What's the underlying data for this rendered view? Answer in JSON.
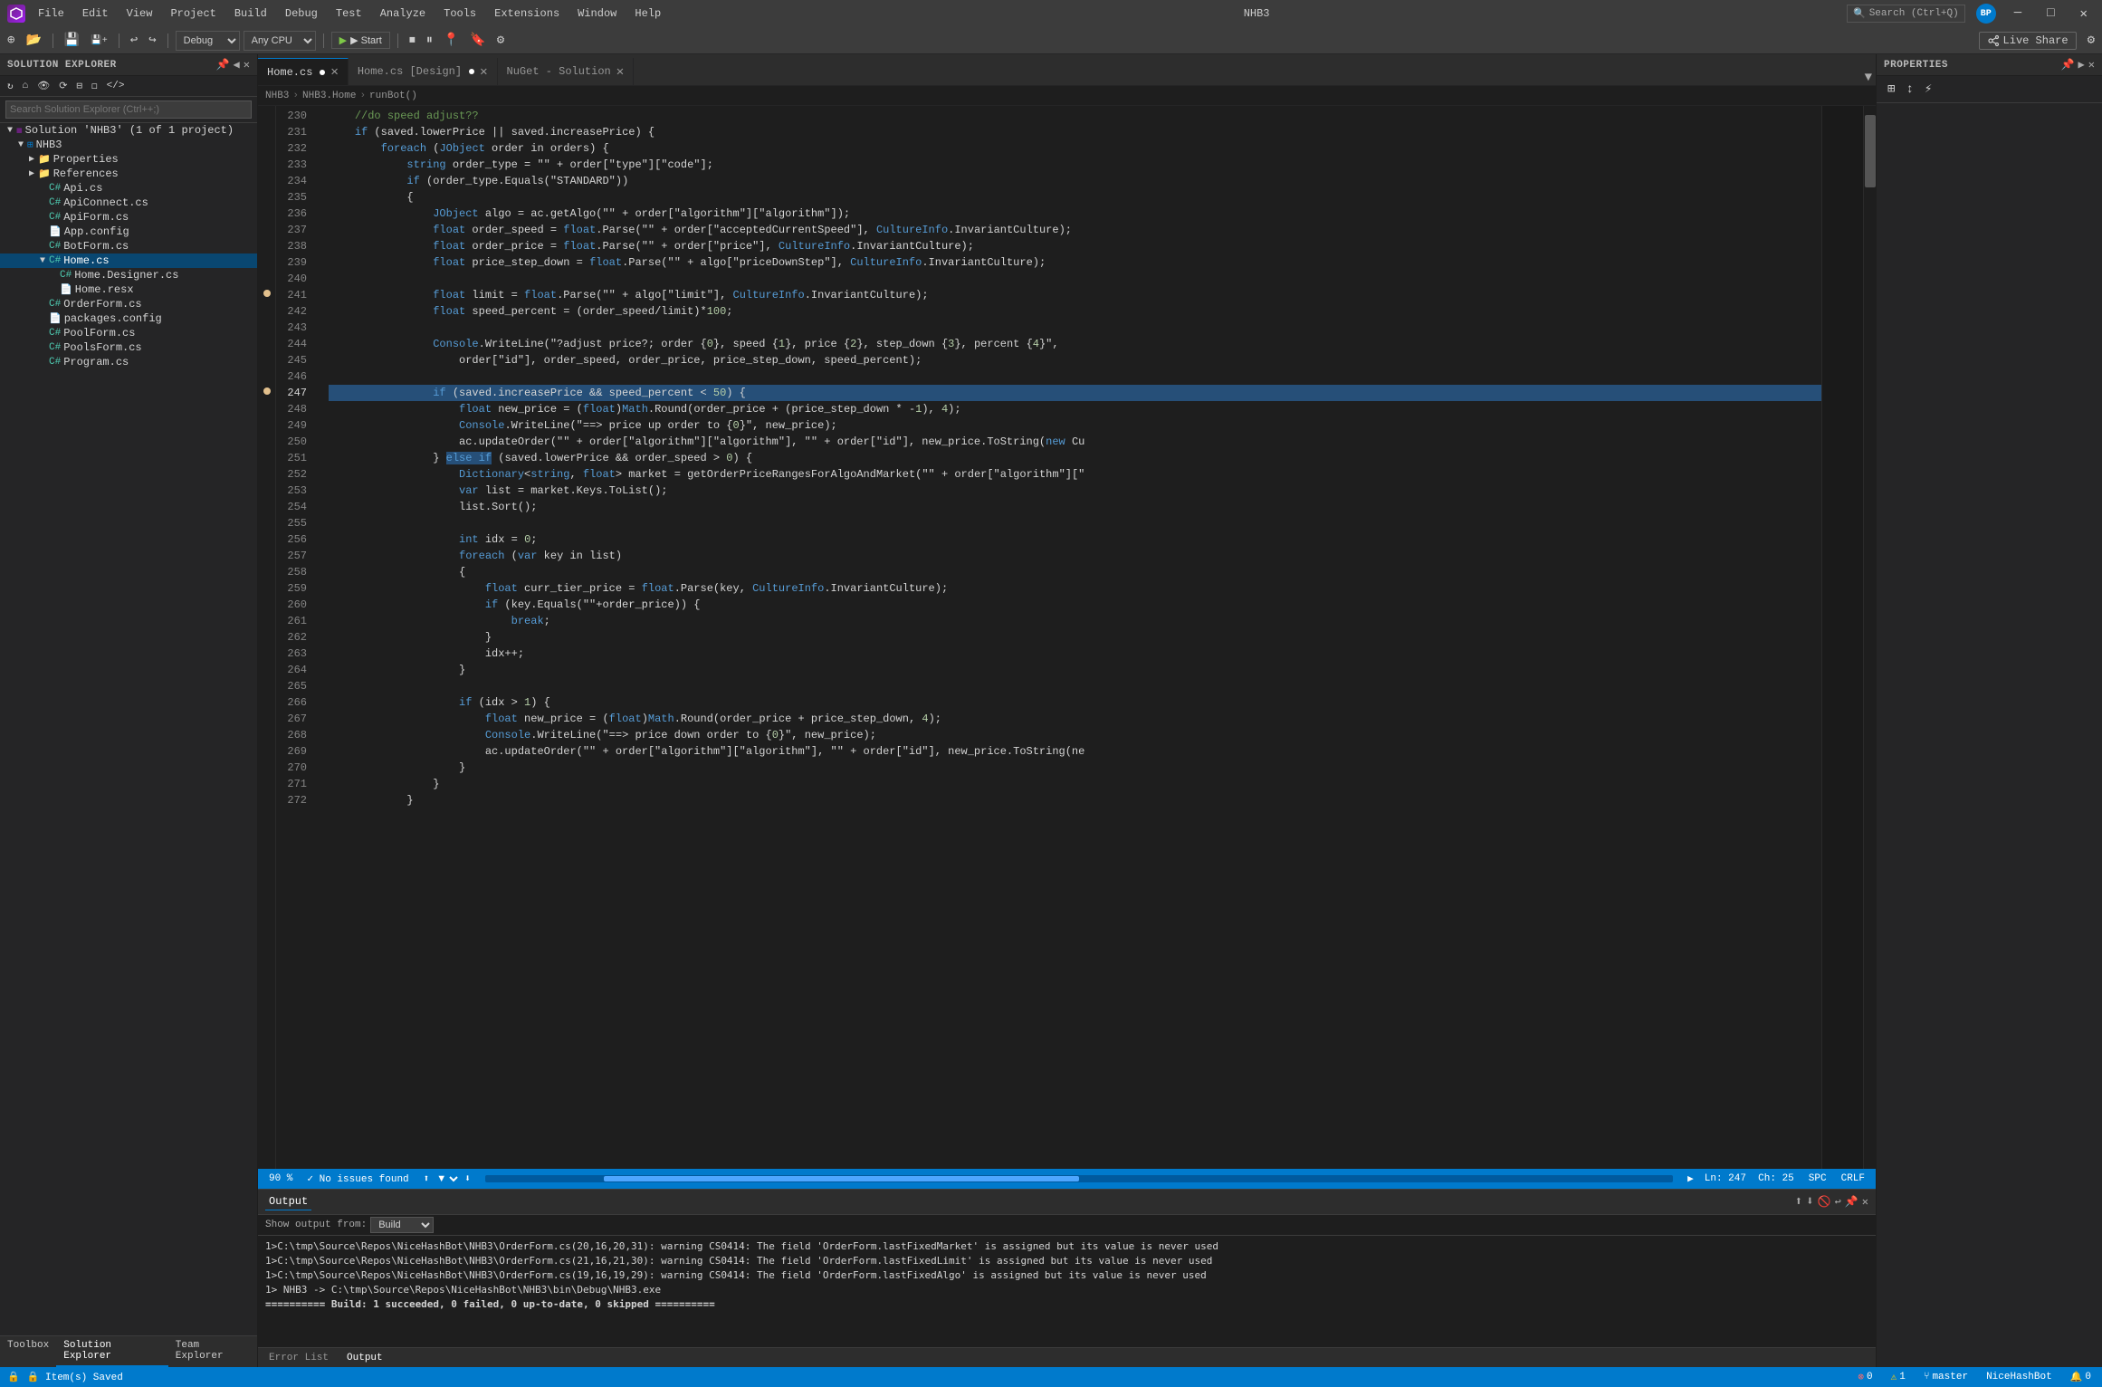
{
  "titleBar": {
    "appName": "NHB3",
    "minimize": "─",
    "maximize": "□",
    "close": "✕"
  },
  "menuBar": {
    "items": [
      "File",
      "Edit",
      "View",
      "Project",
      "Build",
      "Debug",
      "Test",
      "Analyze",
      "Tools",
      "Extensions",
      "Window",
      "Help"
    ]
  },
  "toolbar": {
    "debugMode": "Debug",
    "platform": "Any CPU",
    "startLabel": "▶ Start",
    "liveShare": "Live Share"
  },
  "solutionExplorer": {
    "title": "Solution Explorer",
    "searchPlaceholder": "Search Solution Explorer (Ctrl++;)",
    "tree": [
      {
        "label": "Solution 'NHB3' (1 of 1 project)",
        "indent": 0,
        "type": "solution",
        "arrow": "▼"
      },
      {
        "label": "NHB3",
        "indent": 1,
        "type": "project",
        "arrow": "▼"
      },
      {
        "label": "Properties",
        "indent": 2,
        "type": "folder",
        "arrow": "▶"
      },
      {
        "label": "References",
        "indent": 2,
        "type": "folder",
        "arrow": "▶"
      },
      {
        "label": "Api.cs",
        "indent": 3,
        "type": "cs",
        "arrow": ""
      },
      {
        "label": "ApiConnect.cs",
        "indent": 3,
        "type": "cs",
        "arrow": ""
      },
      {
        "label": "ApiForm.cs",
        "indent": 3,
        "type": "cs",
        "arrow": ""
      },
      {
        "label": "App.config",
        "indent": 3,
        "type": "config",
        "arrow": ""
      },
      {
        "label": "BotForm.cs",
        "indent": 3,
        "type": "cs",
        "arrow": ""
      },
      {
        "label": "Home.cs",
        "indent": 3,
        "type": "cs",
        "arrow": "▼",
        "selected": true
      },
      {
        "label": "Home.Designer.cs",
        "indent": 4,
        "type": "cs",
        "arrow": ""
      },
      {
        "label": "Home.resx",
        "indent": 4,
        "type": "resx",
        "arrow": ""
      },
      {
        "label": "OrderForm.cs",
        "indent": 3,
        "type": "cs",
        "arrow": ""
      },
      {
        "label": "packages.config",
        "indent": 3,
        "type": "config",
        "arrow": ""
      },
      {
        "label": "PoolForm.cs",
        "indent": 3,
        "type": "cs",
        "arrow": ""
      },
      {
        "label": "PoolsForm.cs",
        "indent": 3,
        "type": "cs",
        "arrow": ""
      },
      {
        "label": "Program.cs",
        "indent": 3,
        "type": "cs",
        "arrow": ""
      }
    ]
  },
  "tabs": [
    {
      "label": "Home.cs",
      "modified": true,
      "active": true
    },
    {
      "label": "Home.cs [Design]",
      "modified": true,
      "active": false
    },
    {
      "label": "NuGet - Solution",
      "modified": false,
      "active": false
    }
  ],
  "breadcrumb": {
    "project": "NHB3",
    "namespace": "NHB3.Home",
    "method": "runBot()"
  },
  "codeLines": [
    {
      "num": 230,
      "text": "    //do speed adjust??",
      "marker": ""
    },
    {
      "num": 231,
      "text": "    if (saved.lowerPrice || saved.increasePrice) {",
      "marker": ""
    },
    {
      "num": 232,
      "text": "        foreach (JObject order in orders) {",
      "marker": ""
    },
    {
      "num": 233,
      "text": "            string order_type = \"\" + order[\"type\"][\"code\"];",
      "marker": ""
    },
    {
      "num": 234,
      "text": "            if (order_type.Equals(\"STANDARD\"))",
      "marker": ""
    },
    {
      "num": 235,
      "text": "            {",
      "marker": ""
    },
    {
      "num": 236,
      "text": "                JObject algo = ac.getAlgo(\"\" + order[\"algorithm\"][\"algorithm\"]);",
      "marker": ""
    },
    {
      "num": 237,
      "text": "                float order_speed = float.Parse(\"\" + order[\"acceptedCurrentSpeed\"], CultureInfo.InvariantCulture);",
      "marker": ""
    },
    {
      "num": 238,
      "text": "                float order_price = float.Parse(\"\" + order[\"price\"], CultureInfo.InvariantCulture);",
      "marker": ""
    },
    {
      "num": 239,
      "text": "                float price_step_down = float.Parse(\"\" + algo[\"priceDownStep\"], CultureInfo.InvariantCulture);",
      "marker": ""
    },
    {
      "num": 240,
      "text": "",
      "marker": ""
    },
    {
      "num": 241,
      "text": "                float limit = float.Parse(\"\" + algo[\"limit\"], CultureInfo.InvariantCulture);",
      "marker": "yellow"
    },
    {
      "num": 242,
      "text": "                float speed_percent = (order_speed/limit)*100;",
      "marker": ""
    },
    {
      "num": 243,
      "text": "",
      "marker": ""
    },
    {
      "num": 244,
      "text": "                Console.WriteLine(\"?adjust price?; order {0}, speed {1}, price {2}, step_down {3}, percent {4}\",",
      "marker": ""
    },
    {
      "num": 245,
      "text": "                    order[\"id\"], order_speed, order_price, price_step_down, speed_percent);",
      "marker": ""
    },
    {
      "num": 246,
      "text": "",
      "marker": ""
    },
    {
      "num": 247,
      "text": "                if (saved.increasePrice && speed_percent < 50) {",
      "marker": "yellow",
      "highlighted": true
    },
    {
      "num": 248,
      "text": "                    float new_price = (float)Math.Round(order_price + (price_step_down * -1), 4);",
      "marker": ""
    },
    {
      "num": 249,
      "text": "                    Console.WriteLine(\"==> price up order to {0}\", new_price);",
      "marker": ""
    },
    {
      "num": 250,
      "text": "                    ac.updateOrder(\"\" + order[\"algorithm\"][\"algorithm\"], \"\" + order[\"id\"], new_price.ToString(new Cu",
      "marker": ""
    },
    {
      "num": 251,
      "text": "                } else if (saved.lowerPrice && order_speed > 0) {",
      "marker": "",
      "highlighted2": true
    },
    {
      "num": 252,
      "text": "                    Dictionary<string, float> market = getOrderPriceRangesForAlgoAndMarket(\"\" + order[\"algorithm\"][\"",
      "marker": ""
    },
    {
      "num": 253,
      "text": "                    var list = market.Keys.ToList();",
      "marker": ""
    },
    {
      "num": 254,
      "text": "                    list.Sort();",
      "marker": ""
    },
    {
      "num": 255,
      "text": "",
      "marker": ""
    },
    {
      "num": 256,
      "text": "                    int idx = 0;",
      "marker": ""
    },
    {
      "num": 257,
      "text": "                    foreach (var key in list)",
      "marker": ""
    },
    {
      "num": 258,
      "text": "                    {",
      "marker": ""
    },
    {
      "num": 259,
      "text": "                        float curr_tier_price = float.Parse(key, CultureInfo.InvariantCulture);",
      "marker": ""
    },
    {
      "num": 260,
      "text": "                        if (key.Equals(\"\"+order_price)) {",
      "marker": ""
    },
    {
      "num": 261,
      "text": "                            break;",
      "marker": ""
    },
    {
      "num": 262,
      "text": "                        }",
      "marker": ""
    },
    {
      "num": 263,
      "text": "                        idx++;",
      "marker": ""
    },
    {
      "num": 264,
      "text": "                    }",
      "marker": ""
    },
    {
      "num": 265,
      "text": "",
      "marker": ""
    },
    {
      "num": 266,
      "text": "                    if (idx > 1) {",
      "marker": ""
    },
    {
      "num": 267,
      "text": "                        float new_price = (float)Math.Round(order_price + price_step_down, 4);",
      "marker": ""
    },
    {
      "num": 268,
      "text": "                        Console.WriteLine(\"==> price down order to {0}\", new_price);",
      "marker": ""
    },
    {
      "num": 269,
      "text": "                        ac.updateOrder(\"\" + order[\"algorithm\"][\"algorithm\"], \"\" + order[\"id\"], new_price.ToString(ne",
      "marker": ""
    },
    {
      "num": 270,
      "text": "                    }",
      "marker": ""
    },
    {
      "num": 271,
      "text": "                }",
      "marker": ""
    },
    {
      "num": 272,
      "text": "            }",
      "marker": ""
    }
  ],
  "statusBar": {
    "noIssues": "✓ No issues found",
    "line": "Ln: 247",
    "col": "Ch: 25",
    "spaces": "SPC",
    "lineEnding": "CRLF",
    "zoom": "90 %",
    "branch": "master",
    "user": "NiceHashBot",
    "notifications": "0",
    "errors": "0",
    "warnings": "1"
  },
  "output": {
    "title": "Output",
    "source": "Build",
    "lines": [
      "1>C:\\tmp\\Source\\Repos\\NiceHashBot\\NHB3\\OrderForm.cs(20,16,20,31): warning CS0414: The field 'OrderForm.lastFixedMarket' is assigned but its value is never used",
      "1>C:\\tmp\\Source\\Repos\\NiceHashBot\\NHB3\\OrderForm.cs(21,16,21,30): warning CS0414: The field 'OrderForm.lastFixedLimit' is assigned but its value is never used",
      "1>C:\\tmp\\Source\\Repos\\NiceHashBot\\NHB3\\OrderForm.cs(19,16,19,29): warning CS0414: The field 'OrderForm.lastFixedAlgo' is assigned but its value is never used",
      "1>  NHB3 -> C:\\tmp\\Source\\Repos\\NiceHashBot\\NHB3\\bin\\Debug\\NHB3.exe",
      "========== Build: 1 succeeded, 0 failed, 0 up-to-date, 0 skipped =========="
    ]
  },
  "bottomTabs": [
    {
      "label": "Error List",
      "active": false
    },
    {
      "label": "Output",
      "active": true
    }
  ],
  "bottomStatusBar": {
    "saved": "🔒 Item(s) Saved"
  }
}
